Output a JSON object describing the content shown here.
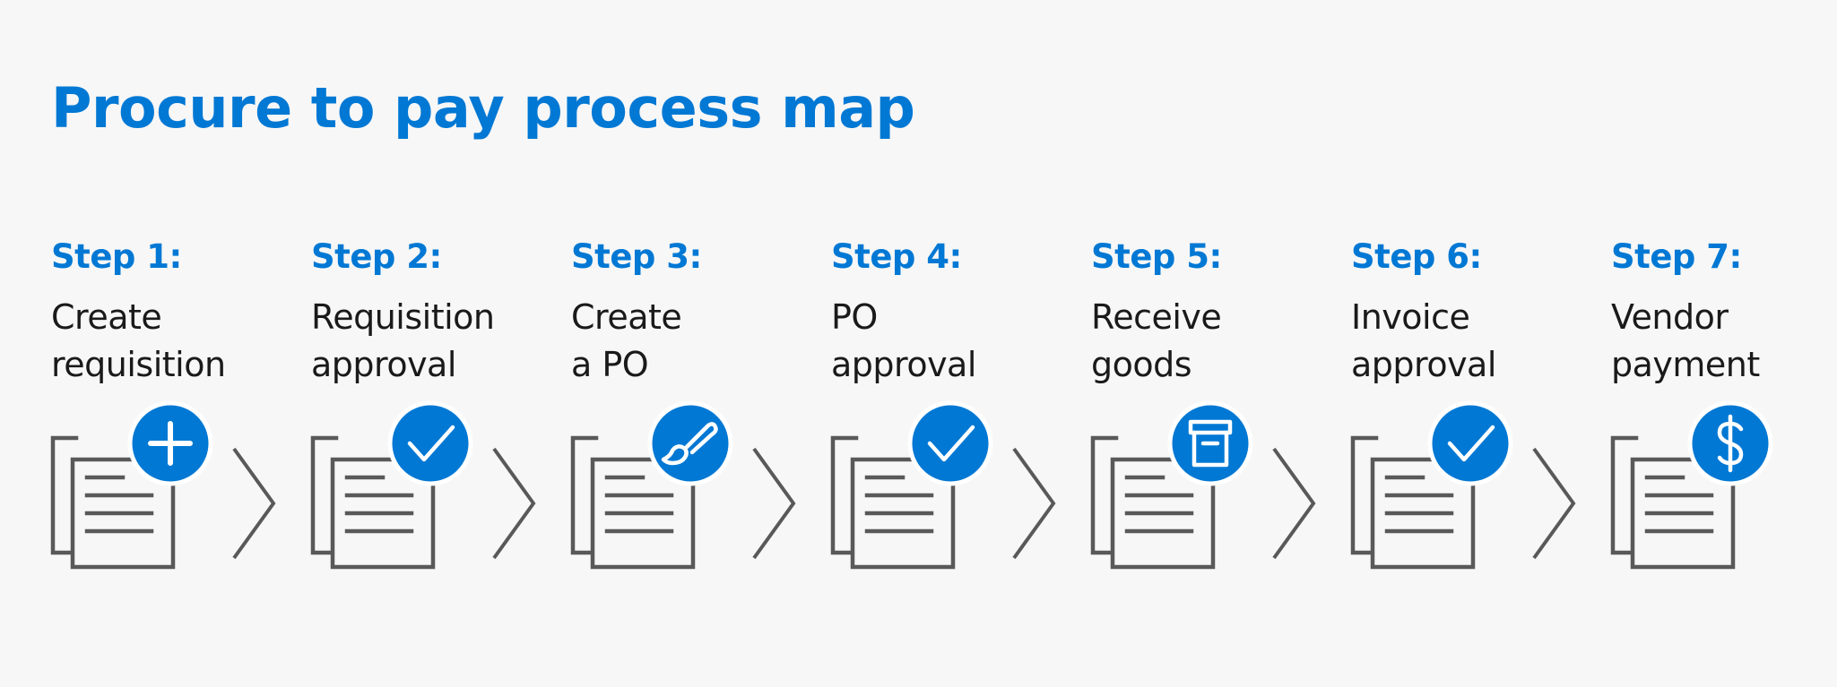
{
  "title": "Procure to pay process map",
  "colors": {
    "accent": "#0078d4",
    "icon_stroke": "#595959",
    "text": "#1a1a1a",
    "background": "#f7f7f7"
  },
  "steps": [
    {
      "label": "Step 1:",
      "lines": [
        "Create",
        "requisition"
      ],
      "badge_icon": "plus-icon"
    },
    {
      "label": "Step 2:",
      "lines": [
        "Requisition",
        "approval"
      ],
      "badge_icon": "checkmark-icon"
    },
    {
      "label": "Step 3:",
      "lines": [
        "Create",
        "a PO"
      ],
      "badge_icon": "paintbrush-icon"
    },
    {
      "label": "Step 4:",
      "lines": [
        "PO",
        "approval"
      ],
      "badge_icon": "checkmark-icon"
    },
    {
      "label": "Step 5:",
      "lines": [
        "Receive",
        "goods"
      ],
      "badge_icon": "archive-box-icon"
    },
    {
      "label": "Step 6:",
      "lines": [
        "Invoice",
        "approval"
      ],
      "badge_icon": "checkmark-icon"
    },
    {
      "label": "Step 7:",
      "lines": [
        "Vendor",
        "payment"
      ],
      "badge_icon": "dollar-icon"
    }
  ]
}
